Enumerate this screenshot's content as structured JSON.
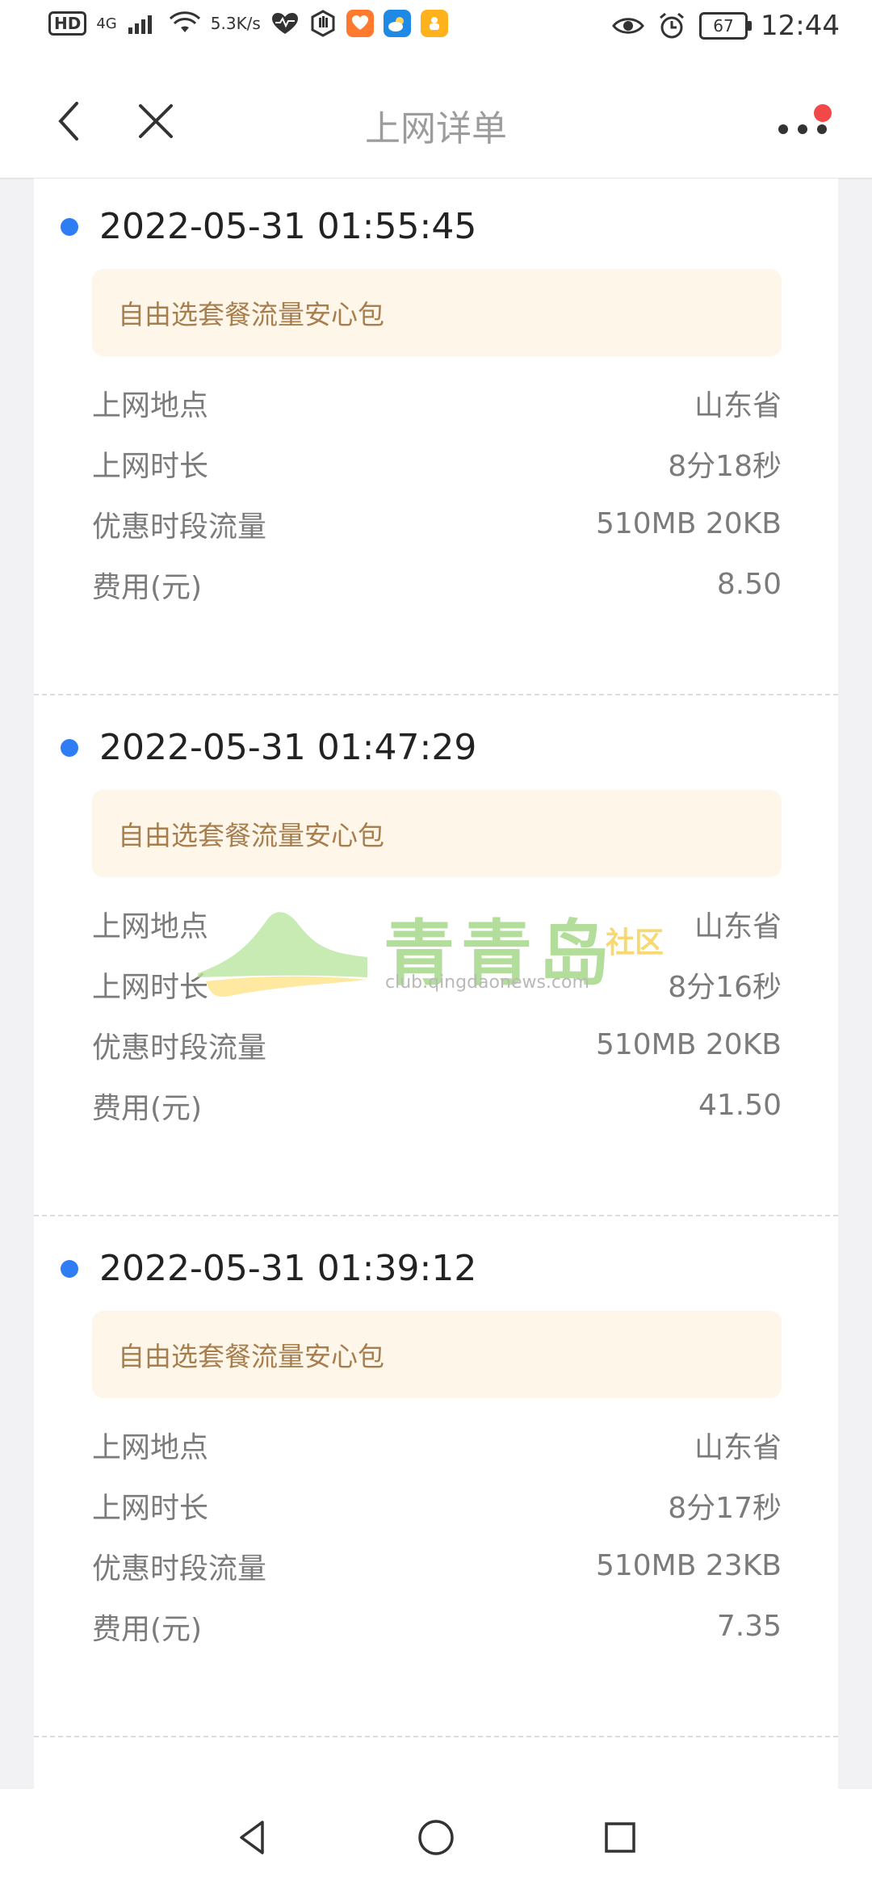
{
  "status_bar": {
    "hd_text": "HD",
    "signal_type": "4G",
    "speed_value": "5.3",
    "speed_unit": "K/s",
    "battery": "67",
    "time": "12:44",
    "icons": [
      "wifi-icon",
      "health-icon",
      "hand-icon",
      "orange-app-icon",
      "weather-app-icon",
      "yellow-app-icon",
      "eye-icon",
      "alarm-icon",
      "battery-icon"
    ]
  },
  "header": {
    "title": "上网详单",
    "icons": [
      "back-chevron-icon",
      "close-icon",
      "more-icon"
    ],
    "badge_color": "#f24848"
  },
  "records": [
    {
      "datetime": "2022-05-31 01:55:45",
      "package": "自由选套餐流量安心包",
      "rows": [
        {
          "label": "上网地点",
          "value": "山东省"
        },
        {
          "label": "上网时长",
          "value": "8分18秒"
        },
        {
          "label": "优惠时段流量",
          "value": "510MB 20KB"
        },
        {
          "label": "费用(元)",
          "value": "8.50"
        }
      ]
    },
    {
      "datetime": "2022-05-31 01:47:29",
      "package": "自由选套餐流量安心包",
      "rows": [
        {
          "label": "上网地点",
          "value": "山东省"
        },
        {
          "label": "上网时长",
          "value": "8分16秒"
        },
        {
          "label": "优惠时段流量",
          "value": "510MB 20KB"
        },
        {
          "label": "费用(元)",
          "value": "41.50"
        }
      ]
    },
    {
      "datetime": "2022-05-31 01:39:12",
      "package": "自由选套餐流量安心包",
      "rows": [
        {
          "label": "上网地点",
          "value": "山东省"
        },
        {
          "label": "上网时长",
          "value": "8分17秒"
        },
        {
          "label": "优惠时段流量",
          "value": "510MB 23KB"
        },
        {
          "label": "费用(元)",
          "value": "7.35"
        }
      ]
    }
  ],
  "watermark": {
    "title": "青青岛",
    "tag": "社区",
    "subtitle": "club.qingdaonews.com"
  },
  "nav_bar": {
    "icons": [
      "nav-back-icon",
      "nav-home-icon",
      "nav-recents-icon"
    ]
  },
  "colors": {
    "bullet": "#2f7df4",
    "pill_bg": "#fff6ea",
    "pill_text": "#a77f4f",
    "label_text": "#7b7b7b",
    "title_text": "#9c9c9c"
  }
}
